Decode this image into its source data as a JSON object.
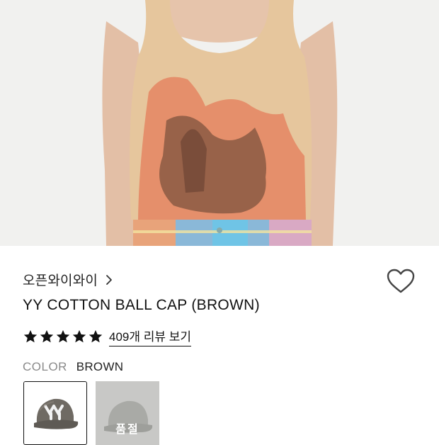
{
  "brand": {
    "name": "오픈와이와이"
  },
  "product": {
    "title": "YY COTTON BALL CAP (BROWN)"
  },
  "rating": {
    "stars": 5,
    "review_link": "409개 리뷰 보기"
  },
  "color": {
    "label": "COLOR",
    "selected": "BROWN",
    "options": [
      {
        "color": "brown",
        "selected": true
      },
      {
        "color": "gray",
        "badge": "품절"
      }
    ]
  },
  "icons": {
    "brand_chevron": "chevron-right-icon",
    "wishlist": "heart-outline-icon",
    "star": "star-filled-icon"
  }
}
